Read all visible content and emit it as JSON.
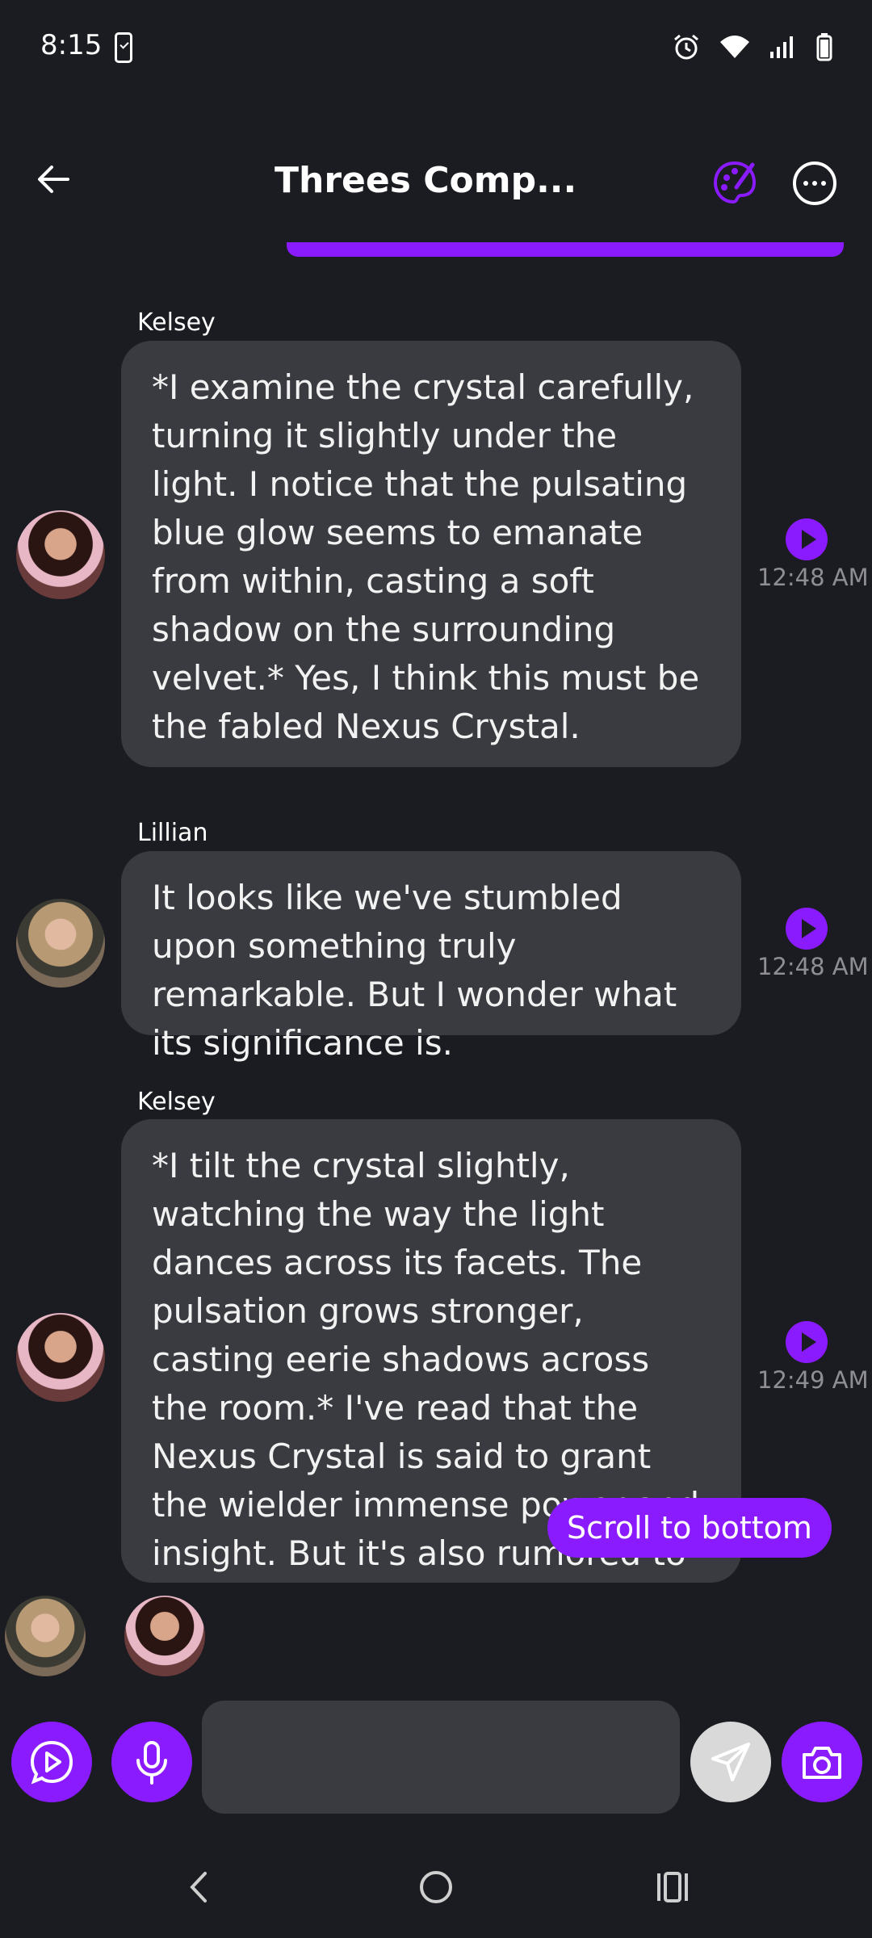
{
  "status_bar": {
    "time": "8:15"
  },
  "header": {
    "title": "Threes Comp...",
    "icons": [
      "back-arrow-icon",
      "palette-icon",
      "more-options-icon"
    ]
  },
  "messages": [
    {
      "sender": "Kelsey",
      "text": "*I examine the crystal carefully, turning it slightly under the light. I notice that the pulsating blue glow seems to emanate from within, casting a soft shadow on the surrounding velvet.* Yes, I think this must be the fabled Nexus Crystal.",
      "time": "12:48 AM"
    },
    {
      "sender": "Lillian",
      "text": "It looks like we've stumbled upon something truly remarkable. But I wonder what its significance is.",
      "time": "12:48 AM"
    },
    {
      "sender": "Kelsey",
      "text": "*I tilt the crystal slightly, watching the way the light dances across its facets. The pulsation grows stronger, casting eerie shadows across the room.* I've read that the Nexus Crystal is said to grant the wielder immense power and insight. But it's also rumored to come with a great cost.",
      "time": "12:49 AM"
    }
  ],
  "scroll_button": "Scroll to bottom",
  "composer": {
    "value": ""
  },
  "colors": {
    "accent": "#8a1bff",
    "bubble": "#3a3b40",
    "background": "#1b1c21"
  }
}
